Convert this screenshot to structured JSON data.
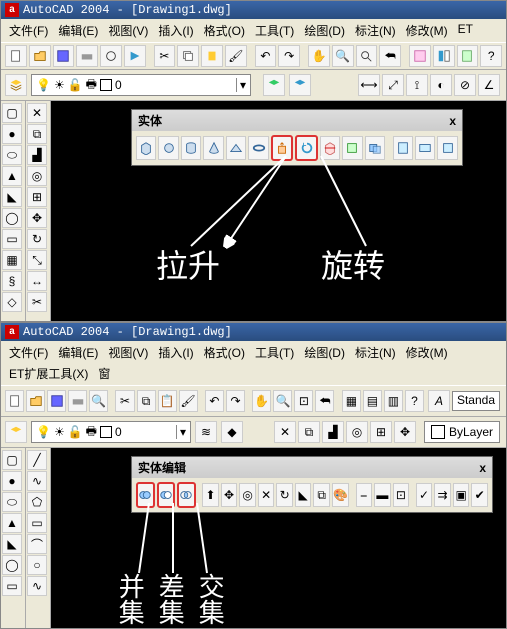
{
  "top": {
    "title": "AutoCAD 2004 - [Drawing1.dwg]",
    "menus": [
      "文件(F)",
      "编辑(E)",
      "视图(V)",
      "插入(I)",
      "格式(O)",
      "工具(T)",
      "绘图(D)",
      "标注(N)",
      "修改(M)",
      "ET"
    ],
    "layer_value": "0",
    "float_title": "实体",
    "float_close": "x",
    "annot_left": "拉升",
    "annot_right": "旋转"
  },
  "bottom": {
    "title": "AutoCAD 2004 - [Drawing1.dwg]",
    "menus": [
      "文件(F)",
      "编辑(E)",
      "视图(V)",
      "插入(I)",
      "格式(O)",
      "工具(T)",
      "绘图(D)",
      "标注(N)",
      "修改(M)",
      "ET扩展工具(X)",
      "窗"
    ],
    "layer_value": "0",
    "style_label": "Standa",
    "bylayer": "ByLayer",
    "float_title": "实体编辑",
    "float_close": "x",
    "annot1": "并集",
    "annot2": "差集",
    "annot3": "交集"
  },
  "icons": {
    "bulb": "💡",
    "sun": "☀",
    "lock": "🔒",
    "square": "▢",
    "tri": "▽",
    "box": "📦",
    "sphere": "⬤",
    "cyl": "⬢",
    "cone": "△",
    "wedge": "◣",
    "torus": "◯",
    "extrude": "⬆",
    "revolve": "↻",
    "slice": "✂",
    "section": "⬒",
    "interfere": "⧉",
    "setup": "⚙",
    "drawing": "📄",
    "profile": "◧",
    "union": "∪",
    "subtract": "−",
    "intersect": "∩"
  }
}
